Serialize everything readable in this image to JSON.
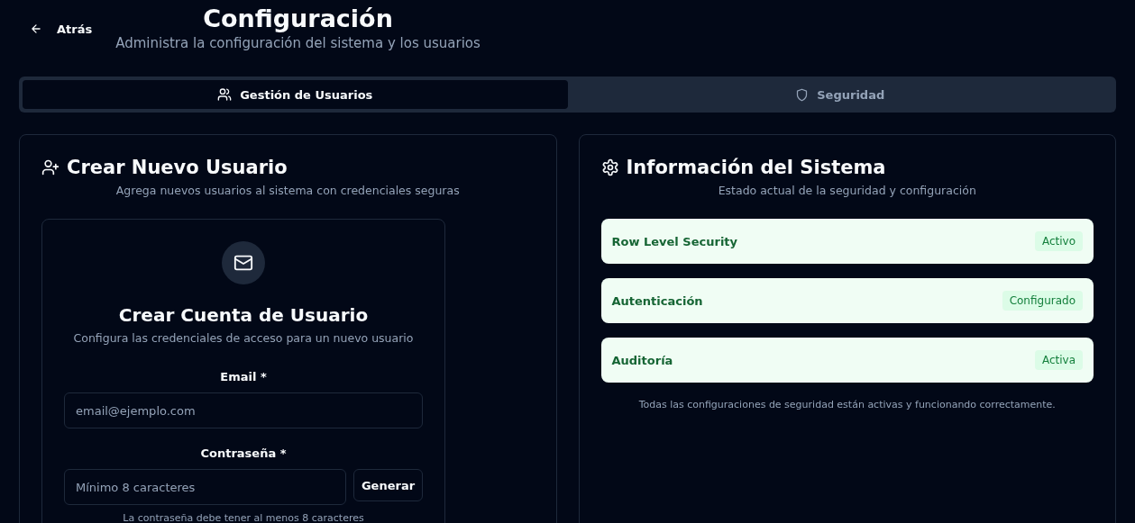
{
  "header": {
    "back": "Atrás",
    "title": "Configuración",
    "subtitle": "Administra la configuración del sistema y los usuarios"
  },
  "tabs": [
    {
      "label": "Gestión de Usuarios",
      "selected": true
    },
    {
      "label": "Seguridad",
      "selected": false
    }
  ],
  "create_user": {
    "title": "Crear Nuevo Usuario",
    "description": "Agrega nuevos usuarios al sistema con credenciales seguras",
    "form": {
      "title": "Crear Cuenta de Usuario",
      "description": "Configura las credenciales de acceso para un nuevo usuario",
      "email": {
        "label": "Email *",
        "placeholder": "email@ejemplo.com"
      },
      "password": {
        "label": "Contraseña *",
        "placeholder": "Mínimo 8 caracteres",
        "button": "Generar",
        "hint": "La contraseña debe tener al menos 8 caracteres"
      }
    }
  },
  "system_info": {
    "title": "Información del Sistema",
    "description": "Estado actual de la seguridad y configuración",
    "items": [
      {
        "label": "Row Level Security",
        "status": "Activo"
      },
      {
        "label": "Autenticación",
        "status": "Configurado"
      },
      {
        "label": "Auditoría",
        "status": "Activa"
      }
    ],
    "footer": "Todas las configuraciones de seguridad están activas y funcionando correctamente."
  }
}
